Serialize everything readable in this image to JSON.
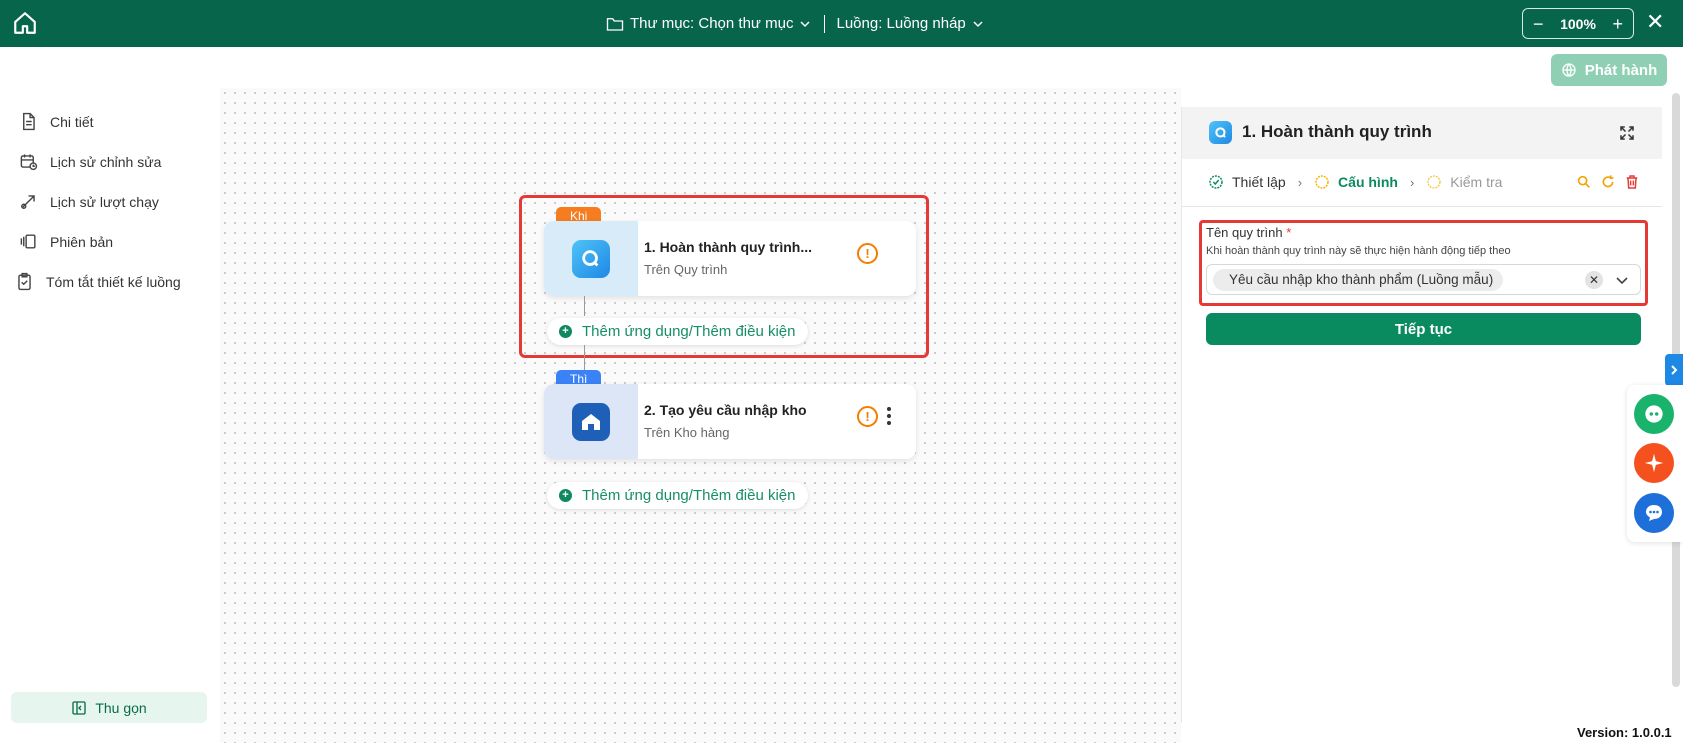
{
  "topbar": {
    "folder_label": "Thư mục: Chọn thư mục",
    "flow_label": "Luồng: Luồng nháp",
    "zoom_value": "100%",
    "zoom_minus": "−",
    "zoom_plus": "+",
    "close": "✕"
  },
  "toolbar": {
    "publish_label": "Phát hành"
  },
  "sidebar": {
    "items": [
      {
        "label": "Chi tiết"
      },
      {
        "label": "Lịch sử chỉnh sửa"
      },
      {
        "label": "Lịch sử lượt chạy"
      },
      {
        "label": "Phiên bản"
      },
      {
        "label": "Tóm tắt thiết kế luồng"
      }
    ],
    "collapse_label": "Thu gọn"
  },
  "canvas": {
    "trigger": {
      "tag": "Khi",
      "title": "1.  Hoàn thành quy trình...",
      "subtitle": "Trên Quy trình",
      "warning": "!"
    },
    "add_label_1": "Thêm ứng dụng/Thêm điều kiện",
    "action": {
      "tag": "Thì",
      "title": "2.  Tạo yêu cầu nhập kho",
      "subtitle": "Trên Kho hàng",
      "warning": "!"
    },
    "add_label_2": "Thêm ứng dụng/Thêm điều kiện"
  },
  "panel": {
    "title": "1. Hoàn thành quy trình",
    "steps": [
      {
        "label": "Thiết lập",
        "state": "done"
      },
      {
        "label": "Cấu hình",
        "state": "active"
      },
      {
        "label": "Kiểm tra",
        "state": "pending"
      }
    ],
    "field": {
      "label": "Tên quy trình",
      "required_mark": "*",
      "help": "Khi hoàn thành quy trình này sẽ thực hiện hành động tiếp theo",
      "selected_value": "Yêu cầu nhập kho thành phẩm (Luồng mẫu)",
      "clear": "✕"
    },
    "continue_label": "Tiếp tục"
  },
  "colors": {
    "brand": "#06654a",
    "accent": "#0a8a5f",
    "warning": "#f57c00",
    "trigger_tag": "#f57c1f",
    "action_tag": "#3b82f6",
    "highlight": "#e53935"
  },
  "version": "Version: 1.0.0.1"
}
